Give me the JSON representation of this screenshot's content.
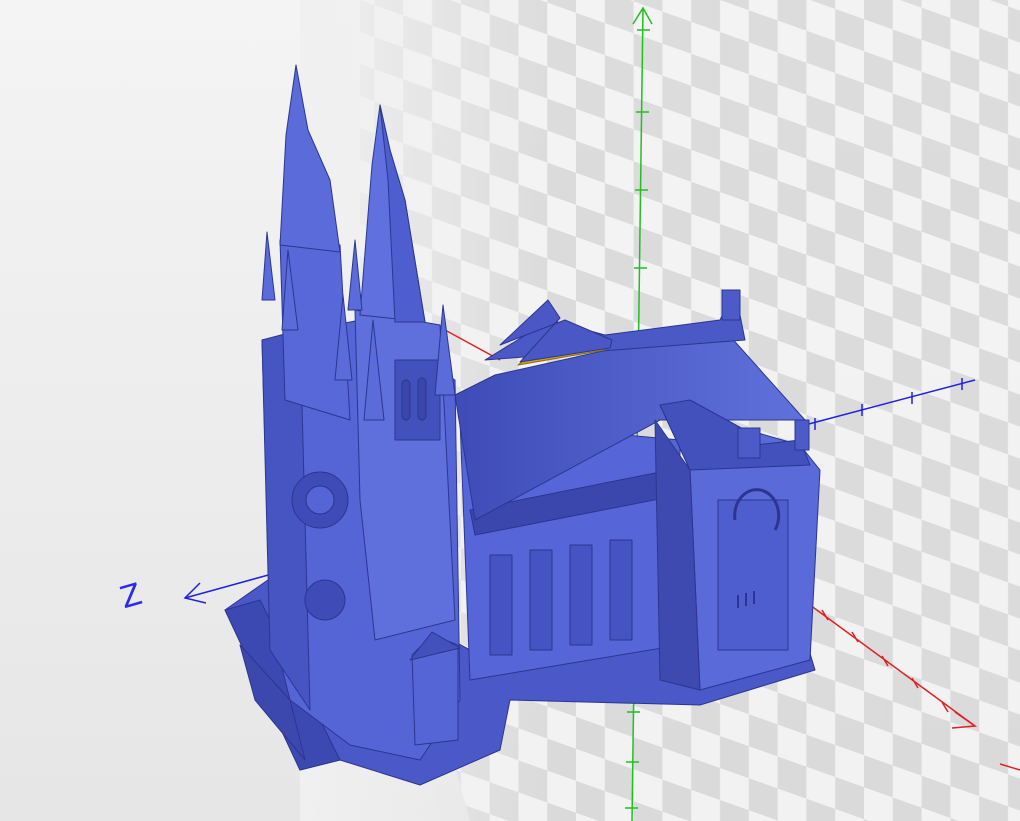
{
  "viewer": {
    "background_color": "#ececec",
    "model_color": "#5262d6",
    "selected_face_color": "#d2a21c"
  },
  "axes": {
    "x": {
      "color": "#e02020"
    },
    "y": {
      "color": "#20c020"
    },
    "z": {
      "color": "#2020e0",
      "label": "Z"
    }
  }
}
